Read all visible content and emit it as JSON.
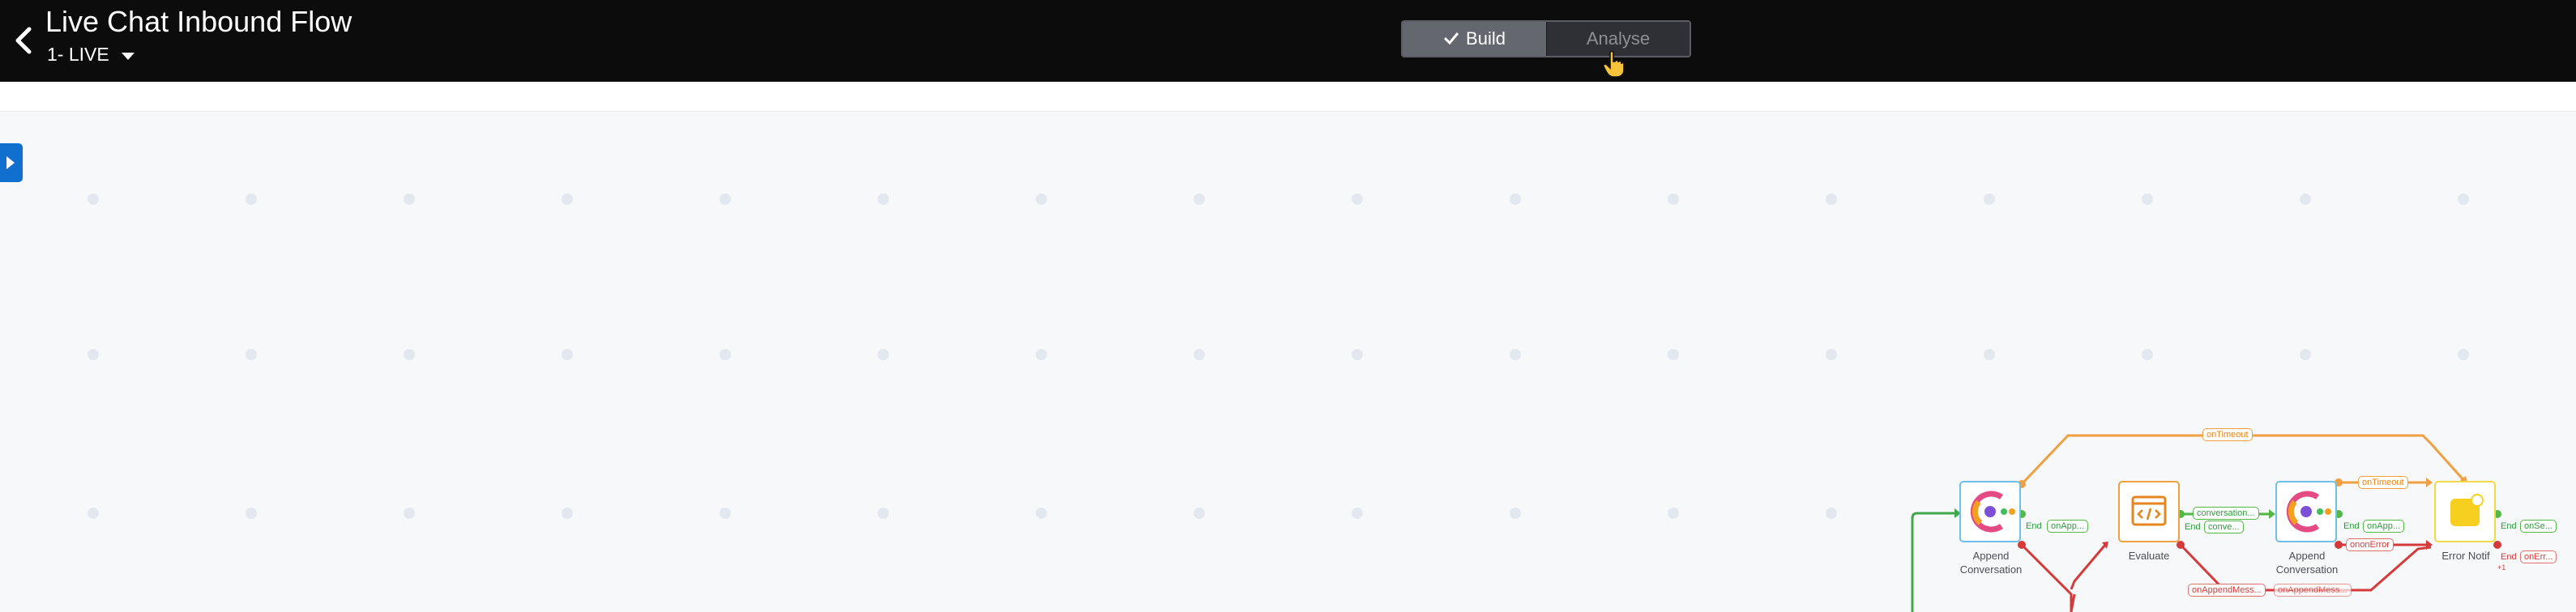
{
  "header": {
    "title": "Live Chat Inbound Flow",
    "version": "1- LIVE",
    "toggle": {
      "build_label": "Build",
      "analyse_label": "Analyse",
      "active": "Build"
    }
  },
  "colors": {
    "topbar": "#0c0c0c",
    "canvas": "#f6f8fa",
    "accent_blue": "#1170cf",
    "success_green": "#54b847",
    "timeout_orange": "#f0a040",
    "error_red": "#d43a3a"
  },
  "canvas": {
    "nodes": [
      {
        "id": "append1",
        "label_line1": "Append",
        "label_line2": "Conversation",
        "icon": "webex-connect-icon"
      },
      {
        "id": "evaluate",
        "label_line1": "Evaluate",
        "label_line2": "",
        "icon": "code-icon"
      },
      {
        "id": "append2",
        "label_line1": "Append",
        "label_line2": "Conversation",
        "icon": "webex-connect-icon"
      },
      {
        "id": "error_notif",
        "label_line1": "Error Notif",
        "label_line2": "",
        "icon": "notification-icon"
      }
    ],
    "edge_labels": {
      "timeout_top": "onTimeout",
      "timeout_mid": "onTimeout",
      "conversation": "conversation...",
      "on_error_mid": "onError",
      "on_append_mess": "onAppendMess...",
      "on_append_mess2": "onAppendMess...",
      "on_error_prefix": "on"
    },
    "end_labels": {
      "append1_end": "End",
      "append1_tag": "onApp...",
      "evaluate_end": "End",
      "evaluate_tag": "conve...",
      "append2_end": "End",
      "append2_tag": "onApp...",
      "error_end1": "End",
      "error_tag1": "onSe...",
      "error_end2": "End",
      "error_tag2": "onErr...",
      "error_more": "+1"
    }
  }
}
